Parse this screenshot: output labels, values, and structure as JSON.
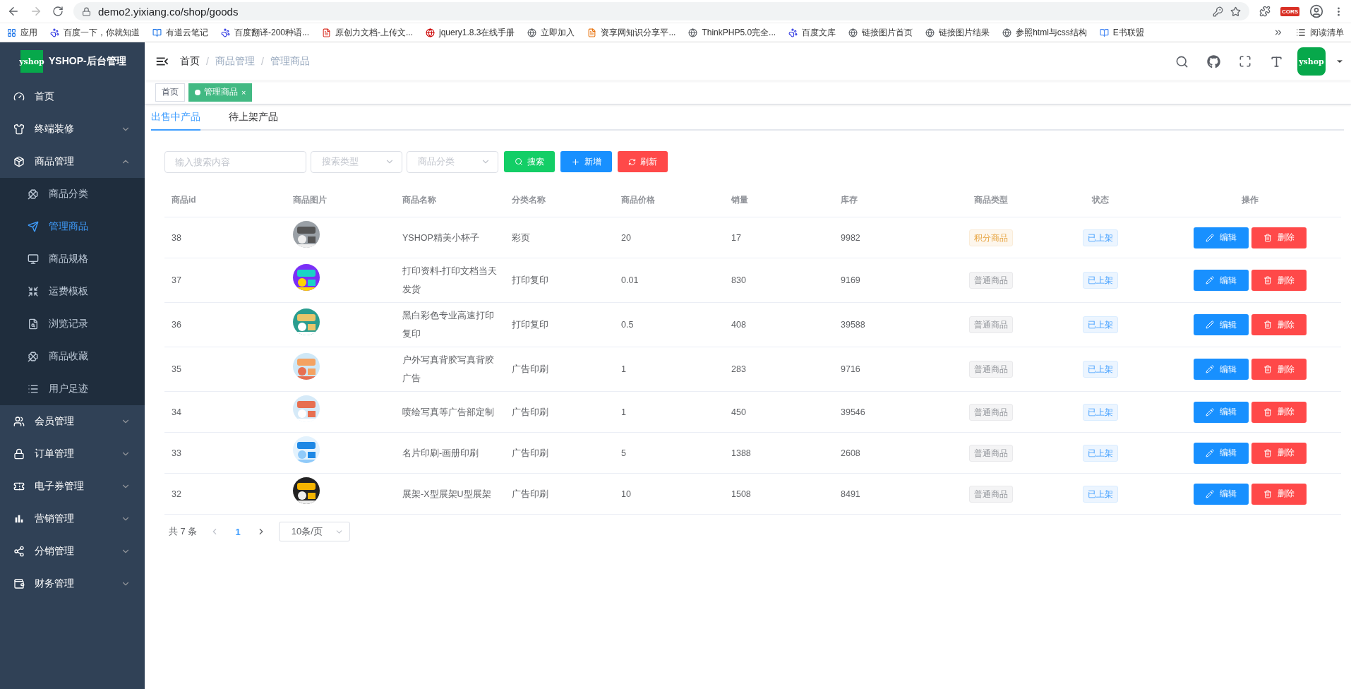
{
  "browser": {
    "url": "demo2.yixiang.co/shop/goods",
    "extension_badge": "CORS",
    "bookmarks": [
      {
        "label": "应用",
        "kind": "apps"
      },
      {
        "label": "百度一下，你就知道",
        "kind": "paw"
      },
      {
        "label": "有道云笔记",
        "kind": "note"
      },
      {
        "label": "百度翻译-200种语...",
        "kind": "paw"
      },
      {
        "label": "原创力文档-上传文...",
        "kind": "doc"
      },
      {
        "label": "jquery1.8.3在线手册",
        "kind": "red"
      },
      {
        "label": "立即加入",
        "kind": "globe"
      },
      {
        "label": "资享网知识分享平...",
        "kind": "zi"
      },
      {
        "label": "ThinkPHP5.0完全...",
        "kind": "globe"
      },
      {
        "label": "百度文库",
        "kind": "paw"
      },
      {
        "label": "链接图片首页",
        "kind": "globe"
      },
      {
        "label": "链接图片结果",
        "kind": "globe"
      },
      {
        "label": "参照html与css结构",
        "kind": "globe"
      },
      {
        "label": "E书联盟",
        "kind": "ebook"
      }
    ],
    "reading_list": "阅读清单"
  },
  "sidebar": {
    "title": "YSHOP-后台管理",
    "logo_text": "yshop",
    "menu": [
      {
        "label": "首页",
        "selected": false
      },
      {
        "label": "终端装修",
        "expanded": false
      },
      {
        "label": "商品管理",
        "expanded": true,
        "children": [
          {
            "label": "商品分类",
            "selected": false
          },
          {
            "label": "管理商品",
            "selected": true
          },
          {
            "label": "商品规格",
            "selected": false
          },
          {
            "label": "运费模板",
            "selected": false
          },
          {
            "label": "浏览记录",
            "selected": false
          },
          {
            "label": "商品收藏",
            "selected": false
          },
          {
            "label": "用户足迹",
            "selected": false
          }
        ]
      },
      {
        "label": "会员管理",
        "expanded": false
      },
      {
        "label": "订单管理",
        "expanded": false
      },
      {
        "label": "电子券管理",
        "expanded": false
      },
      {
        "label": "营销管理",
        "expanded": false
      },
      {
        "label": "分销管理",
        "expanded": false
      },
      {
        "label": "财务管理",
        "expanded": false
      }
    ]
  },
  "header": {
    "breadcrumb": [
      "首页",
      "商品管理",
      "管理商品"
    ],
    "separator": "/",
    "avatar_text": "yshop"
  },
  "tag_views": [
    {
      "label": "首页",
      "selected": false
    },
    {
      "label": "管理商品",
      "selected": true,
      "close": "×"
    }
  ],
  "tabs": [
    {
      "label": "出售中产品",
      "selected": true
    },
    {
      "label": "待上架产品",
      "selected": false
    }
  ],
  "toolbar": {
    "search": {
      "placeholder": "输入搜索内容"
    },
    "selects": [
      {
        "placeholder": "搜索类型"
      },
      {
        "placeholder": "商品分类"
      }
    ],
    "buttons": [
      {
        "label": "搜索",
        "kind": "search"
      },
      {
        "label": "新增",
        "kind": "add"
      },
      {
        "label": "刷新",
        "kind": "refresh"
      }
    ]
  },
  "table": {
    "columns": [
      "商品id",
      "商品图片",
      "商品名称",
      "分类名称",
      "商品价格",
      "销量",
      "库存",
      "商品类型",
      "状态",
      "操作"
    ],
    "rows": [
      {
        "id": "38",
        "name": "YSHOP精美小杯子",
        "category": "彩页",
        "price": "20",
        "sales": "17",
        "stock": "9982",
        "type": {
          "label": "积分商品",
          "kind": "points"
        },
        "status": "已上架",
        "actions": [
          "编辑",
          "删除"
        ]
      },
      {
        "id": "37",
        "name": "打印资料-打印文档当天发货",
        "category": "打印复印",
        "price": "0.01",
        "sales": "830",
        "stock": "9169",
        "type": {
          "label": "普通商品",
          "kind": "normal"
        },
        "status": "已上架",
        "actions": [
          "编辑",
          "删除"
        ]
      },
      {
        "id": "36",
        "name": "黑白彩色专业高速打印复印",
        "category": "打印复印",
        "price": "0.5",
        "sales": "408",
        "stock": "39588",
        "type": {
          "label": "普通商品",
          "kind": "normal"
        },
        "status": "已上架",
        "actions": [
          "编辑",
          "删除"
        ]
      },
      {
        "id": "35",
        "name": "户外写真背胶写真背胶广告",
        "category": "广告印刷",
        "price": "1",
        "sales": "283",
        "stock": "9716",
        "type": {
          "label": "普通商品",
          "kind": "normal"
        },
        "status": "已上架",
        "actions": [
          "编辑",
          "删除"
        ]
      },
      {
        "id": "34",
        "name": "喷绘写真等广告部定制",
        "category": "广告印刷",
        "price": "1",
        "sales": "450",
        "stock": "39546",
        "type": {
          "label": "普通商品",
          "kind": "normal"
        },
        "status": "已上架",
        "actions": [
          "编辑",
          "删除"
        ]
      },
      {
        "id": "33",
        "name": "名片印刷-画册印刷",
        "category": "广告印刷",
        "price": "5",
        "sales": "1388",
        "stock": "2608",
        "type": {
          "label": "普通商品",
          "kind": "normal"
        },
        "status": "已上架",
        "actions": [
          "编辑",
          "删除"
        ]
      },
      {
        "id": "32",
        "name": "展架-X型展架U型展架",
        "category": "广告印刷",
        "price": "10",
        "sales": "1508",
        "stock": "8491",
        "type": {
          "label": "普通商品",
          "kind": "normal"
        },
        "status": "已上架",
        "actions": [
          "编辑",
          "删除"
        ]
      }
    ]
  },
  "pagination": {
    "total": "共 7 条",
    "pages": [
      {
        "label": "1",
        "selected": true
      }
    ],
    "page_size": "10条/页"
  }
}
